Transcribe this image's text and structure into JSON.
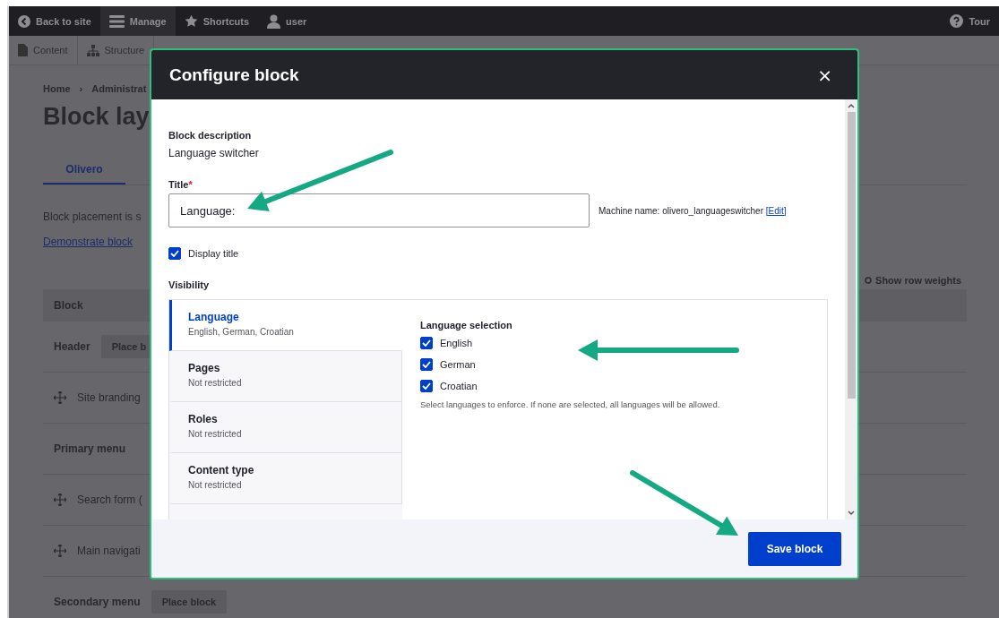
{
  "toolbar": {
    "items": [
      {
        "label": "Back to site",
        "kind": "back",
        "selected": false
      },
      {
        "label": "Manage",
        "kind": "menu",
        "selected": true
      },
      {
        "label": "Shortcuts",
        "kind": "star",
        "selected": false
      },
      {
        "label": "user",
        "kind": "user",
        "selected": false
      }
    ],
    "tour": "Tour"
  },
  "admin_menu": [
    {
      "label": "Content",
      "kind": "page"
    },
    {
      "label": "Structure",
      "kind": "tree"
    }
  ],
  "breadcrumb": {
    "items": [
      "Home",
      "Administrat"
    ],
    "separator": "›"
  },
  "page_title": "Block lay",
  "tabs": [
    {
      "label": "Olivero",
      "selected": true
    }
  ],
  "intro": "Block placement is s",
  "demo_link": "Demonstrate block",
  "show_row_weights": "Show row weights",
  "table": {
    "header": "Block",
    "rows": [
      {
        "kind": "region",
        "label": "Header",
        "button": "Place b"
      },
      {
        "kind": "block",
        "label": "Site branding"
      },
      {
        "kind": "region",
        "label": "Primary menu"
      },
      {
        "kind": "block",
        "label": "Search form ("
      },
      {
        "kind": "block",
        "label": "Main navigati"
      },
      {
        "kind": "region",
        "label": "Secondary menu",
        "button": "Place block"
      }
    ]
  },
  "dialog": {
    "title": "Configure block",
    "close": "×",
    "description_label": "Block description",
    "description": "Language switcher",
    "title_label": "Title",
    "required_mark": "*",
    "title_value": "Language:",
    "machine_name": "Machine name: olivero_languageswitcher",
    "machine_edit": "[Edit]",
    "display_title": {
      "label": "Display title",
      "checked": true
    },
    "visibility_label": "Visibility",
    "visibility_tabs": [
      {
        "title": "Language",
        "summary": "English, German, Croatian",
        "selected": true
      },
      {
        "title": "Pages",
        "summary": "Not restricted",
        "selected": false
      },
      {
        "title": "Roles",
        "summary": "Not restricted",
        "selected": false
      },
      {
        "title": "Content type",
        "summary": "Not restricted",
        "selected": false
      }
    ],
    "language_selection": {
      "label": "Language selection",
      "options": [
        {
          "label": "English",
          "checked": true
        },
        {
          "label": "German",
          "checked": true
        },
        {
          "label": "Croatian",
          "checked": true
        }
      ],
      "help": "Select languages to enforce. If none are selected, all languages will be allowed."
    },
    "save": "Save block"
  }
}
